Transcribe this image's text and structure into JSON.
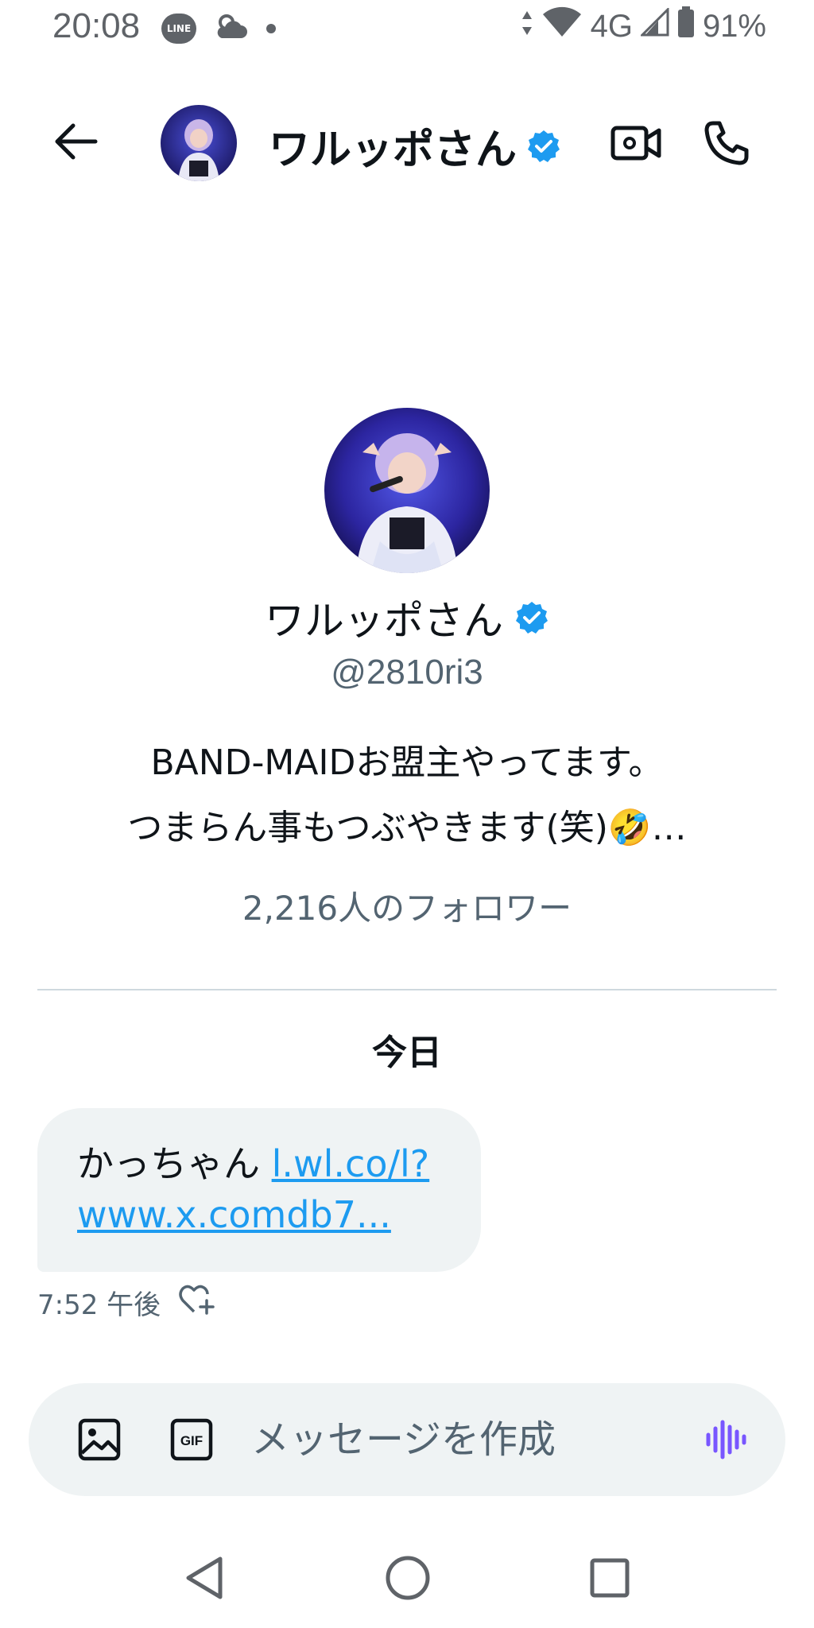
{
  "status_bar": {
    "time": "20:08",
    "line_label": "LINE",
    "network": "4G",
    "battery": "91%"
  },
  "header": {
    "name": "ワルッポさん",
    "icons": [
      "back-arrow-icon",
      "verified-badge-icon",
      "video-call-icon",
      "phone-icon"
    ]
  },
  "profile": {
    "name": "ワルッポさん",
    "handle": "@2810ri3",
    "bio_line1": "BAND-MAIDお盟主やってます。",
    "bio_line2": "つまらん事もつぶやきます(笑)🤣…",
    "followers": "2,216人のフォロワー"
  },
  "conversation": {
    "date_label": "今日",
    "message": {
      "text": "かっちゃん ",
      "link_line1": "l.wl.co/l?",
      "link_line2": "www.x.comdb7...",
      "time": "7:52 午後"
    }
  },
  "composer": {
    "placeholder": "メッセージを作成",
    "gif_label": "GIF"
  },
  "colors": {
    "accent": "#1d9bf0",
    "voice": "#7856ff",
    "muted": "#536471",
    "bubble": "#eff3f4"
  }
}
